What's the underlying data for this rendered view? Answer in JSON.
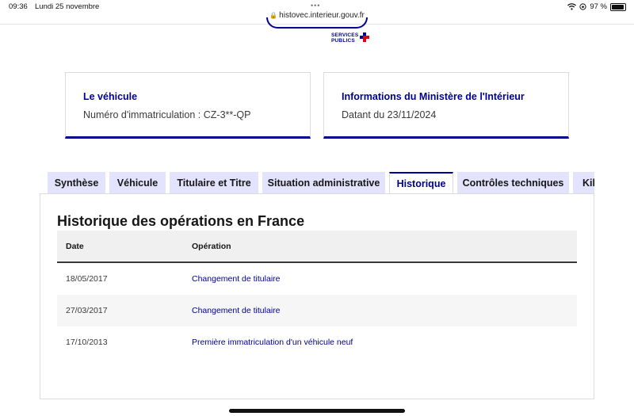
{
  "status_bar": {
    "time": "09:36",
    "date": "Lundi 25 novembre",
    "battery": "97 %",
    "wifi_icon": "wifi-icon",
    "lock_rotation_icon": "orientation-lock-icon"
  },
  "browser": {
    "url": "histovec.interieur.gouv.fr"
  },
  "logo": {
    "line1": "SERVICES",
    "line2": "PUBLICS"
  },
  "cards": {
    "vehicle": {
      "title": "Le véhicule",
      "text": "Numéro d'immatriculation : CZ-3**-QP"
    },
    "ministry": {
      "title": "Informations du Ministère de l'Intérieur",
      "text": "Datant du 23/11/2024"
    }
  },
  "tabs": [
    {
      "label": "Synthèse"
    },
    {
      "label": "Véhicule"
    },
    {
      "label": "Titulaire et Titre"
    },
    {
      "label": "Situation administrative"
    },
    {
      "label": "Historique"
    },
    {
      "label": "Contrôles techniques"
    },
    {
      "label": "Kilométrage"
    }
  ],
  "history": {
    "title": "Historique des opérations en France",
    "columns": {
      "date": "Date",
      "operation": "Opération"
    },
    "rows": [
      {
        "date": "18/05/2017",
        "operation": "Changement de titulaire"
      },
      {
        "date": "27/03/2017",
        "operation": "Changement de titulaire"
      },
      {
        "date": "17/10/2013",
        "operation": "Première immatriculation d'un véhicule neuf"
      }
    ]
  },
  "colors": {
    "brand_blue": "#000091",
    "tab_bg": "#e3e3fd",
    "marianne_red": "#e1000f"
  }
}
